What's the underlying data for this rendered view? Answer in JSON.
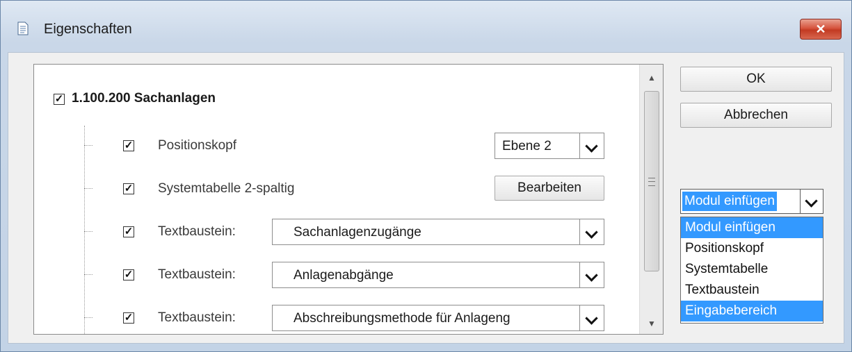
{
  "window": {
    "title": "Eigenschaften",
    "close_label": "✕"
  },
  "tree": {
    "root": {
      "checked": true,
      "label": "1.100.200 Sachanlagen"
    },
    "rows": [
      {
        "checked": true,
        "label": "Positionskopf",
        "control": "combo",
        "value": "Ebene 2"
      },
      {
        "checked": true,
        "label": "Systemtabelle 2-spaltig",
        "control": "button",
        "value": "Bearbeiten"
      },
      {
        "checked": true,
        "label": "Textbaustein:",
        "control": "combo",
        "value": "Sachanlagenzugänge"
      },
      {
        "checked": true,
        "label": "Textbaustein:",
        "control": "combo",
        "value": "Anlagenabgänge"
      },
      {
        "checked": true,
        "label": "Textbaustein:",
        "control": "combo",
        "value": "Abschreibungsmethode für Anlageng"
      }
    ]
  },
  "buttons": {
    "ok": "OK",
    "cancel": "Abbrechen"
  },
  "module_select": {
    "selected": "Modul einfügen",
    "options": [
      "Modul einfügen",
      "Positionskopf",
      "Systemtabelle",
      "Textbaustein",
      "Eingabebereich"
    ],
    "highlighted": [
      "Modul einfügen",
      "Eingabebereich"
    ]
  },
  "colors": {
    "selection": "#3399ff",
    "close_button": "#c23a22"
  }
}
